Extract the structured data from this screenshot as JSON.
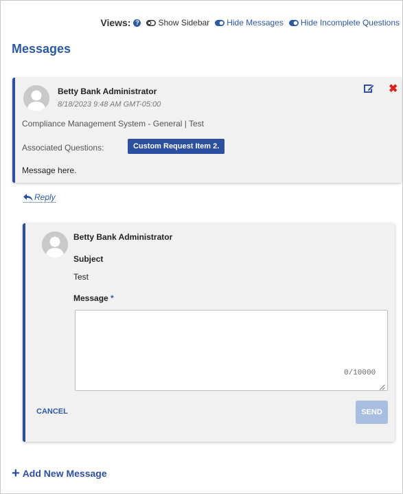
{
  "views": {
    "label": "Views:",
    "help_symbol": "?",
    "toggles": [
      {
        "label": "Show Sidebar",
        "icon": "toggle-off-icon"
      },
      {
        "label": "Hide Messages",
        "icon": "toggle-on-icon"
      },
      {
        "label": "Hide Incomplete Questions",
        "icon": "toggle-on-icon"
      }
    ]
  },
  "page_title": "Messages",
  "message": {
    "author": "Betty Bank Administrator",
    "timestamp": "8/18/2023 9:48 AM GMT-05:00",
    "category": "Compliance Management System - General | Test",
    "associated_label": "Associated Questions:",
    "associated_item": "Custom Request Item 2.",
    "body": "Message here.",
    "delete_symbol": "✖"
  },
  "reply": {
    "label": "Reply"
  },
  "reply_form": {
    "author": "Betty Bank Administrator",
    "subject_label": "Subject",
    "subject_value": "Test",
    "message_label": "Message",
    "required_marker": "*",
    "message_value": "",
    "char_count": "0/10000",
    "cancel_label": "CANCEL",
    "send_label": "SEND"
  },
  "add_message": {
    "plus": "+",
    "label": "Add New Message"
  },
  "colors": {
    "brand_blue": "#2c4fa0",
    "link_blue": "#2c5aa0",
    "delete_red": "#d9211c",
    "send_disabled": "#a8bee0",
    "card_bg": "#f1f1f1"
  }
}
